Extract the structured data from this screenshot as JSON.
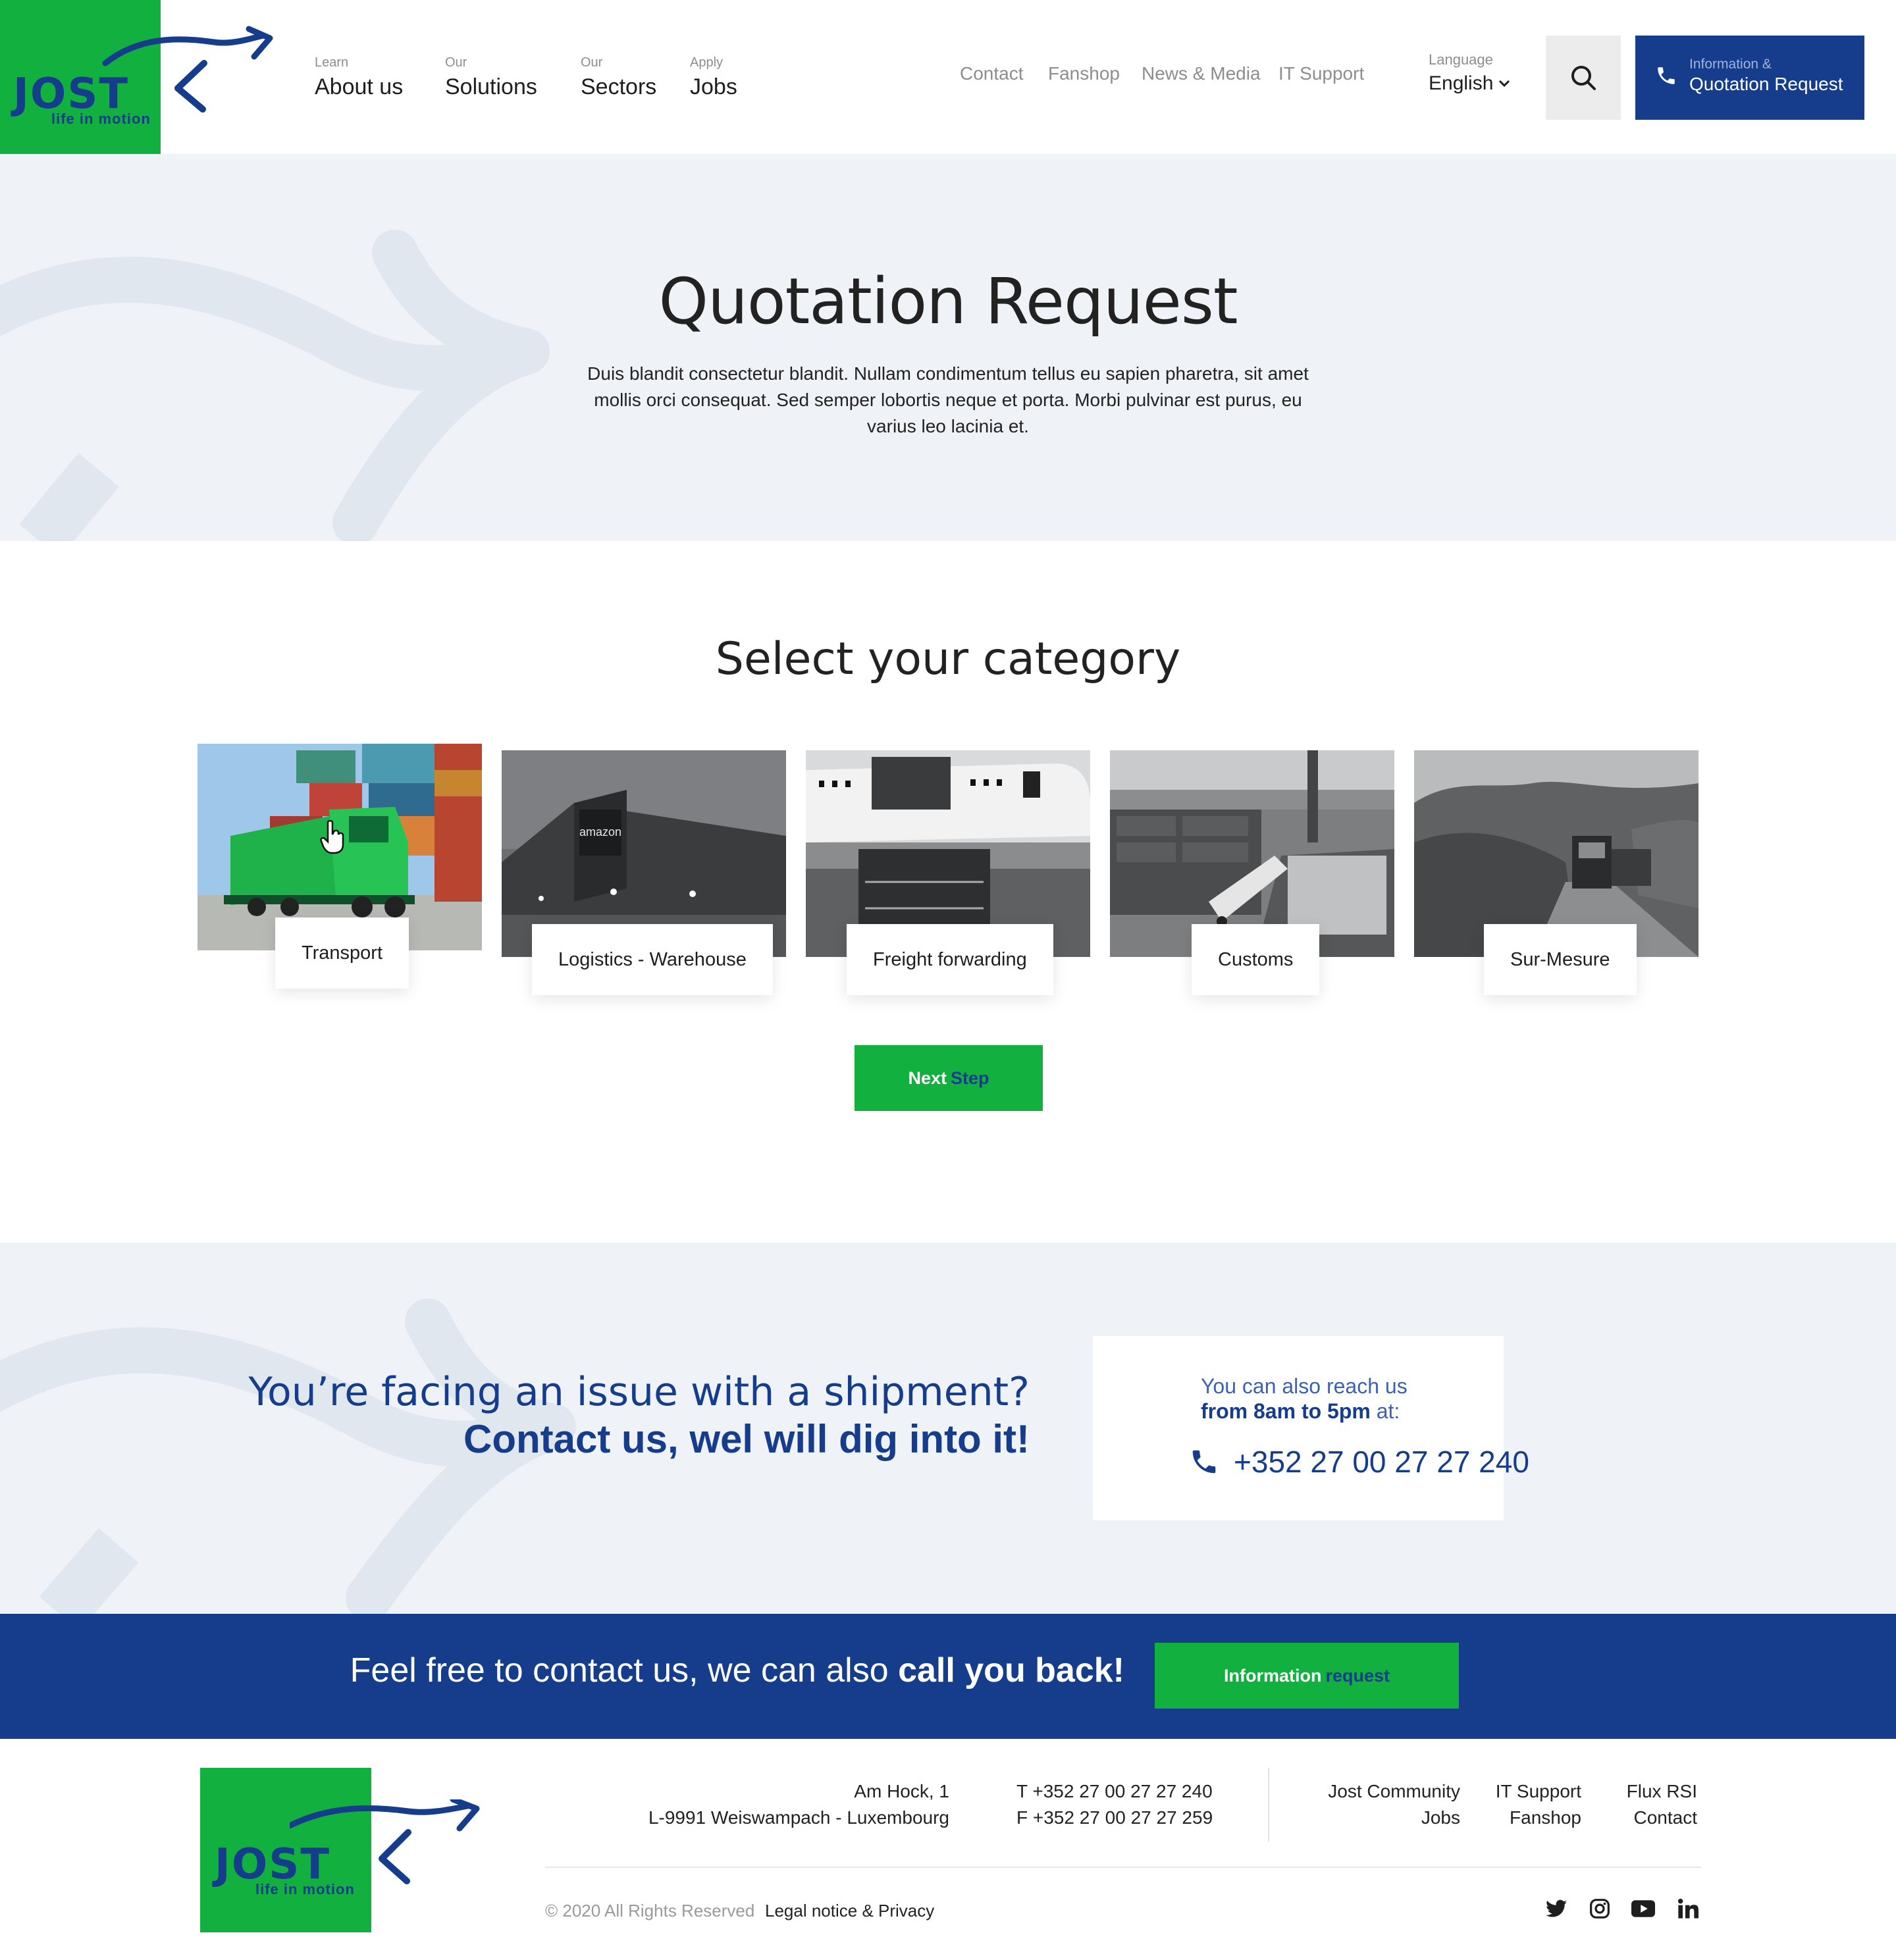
{
  "header": {
    "logo_word": "JOST",
    "logo_tagline": "life in motion",
    "main_nav": [
      {
        "small": "Learn",
        "label": "About us"
      },
      {
        "small": "Our",
        "label": "Solutions"
      },
      {
        "small": "Our",
        "label": "Sectors"
      },
      {
        "small": "Apply",
        "label": "Jobs"
      }
    ],
    "secondary_nav": [
      "Contact",
      "Fanshop",
      "News & Media",
      "IT Support"
    ],
    "language": {
      "label": "Language",
      "value": "English"
    },
    "quote_button": {
      "small": "Information &",
      "label": "Quotation Request"
    }
  },
  "hero": {
    "title": "Quotation Request",
    "text": "Duis blandit consectetur blandit. Nullam condimentum tellus eu sapien pharetra, sit amet mollis orci consequat. Sed semper lobortis neque et porta. Morbi pulvinar est purus, eu varius leo lacinia et."
  },
  "categories": {
    "title": "Select your category",
    "items": [
      {
        "label": "Transport",
        "selected": true
      },
      {
        "label": "Logistics - Warehouse",
        "selected": false
      },
      {
        "label": "Freight forwarding",
        "selected": false
      },
      {
        "label": "Customs",
        "selected": false
      },
      {
        "label": "Sur-Mesure",
        "selected": false
      }
    ],
    "next_button": {
      "part1": "Next",
      "part2": "Step"
    }
  },
  "issue": {
    "line1": "You’re facing an issue with a shipment?",
    "line2": "Contact us, wel will dig into it!",
    "reach_line1": "You can also reach us",
    "reach_hours": "from 8am to 5pm",
    "reach_at": "at:",
    "phone": "+352 27 00 27 27 240"
  },
  "banner": {
    "text": "Feel free to contact us, we can also",
    "text_strong": "call you back!",
    "button": {
      "part1": "Information",
      "part2": "request"
    }
  },
  "footer": {
    "address_line1": "Am Hock, 1",
    "address_line2": "L-9991 Weiswampach - Luxembourg",
    "tel": "T  +352 27 00 27 27 240",
    "fax": "F  +352 27 00 27 27 259",
    "links_col1": [
      "Jost Community",
      "Jobs"
    ],
    "links_col2": [
      "IT Support",
      "Fanshop"
    ],
    "links_col3": [
      "Flux RSI",
      "Contact"
    ],
    "copyright": "© 2020 All Rights Reserved",
    "legal": "Legal notice & Privacy",
    "social": [
      "twitter-icon",
      "instagram-icon",
      "youtube-icon",
      "linkedin-icon"
    ]
  },
  "colors": {
    "brand_green": "#12b03f",
    "brand_blue": "#163d8c",
    "light_bg": "#eff2f6"
  }
}
